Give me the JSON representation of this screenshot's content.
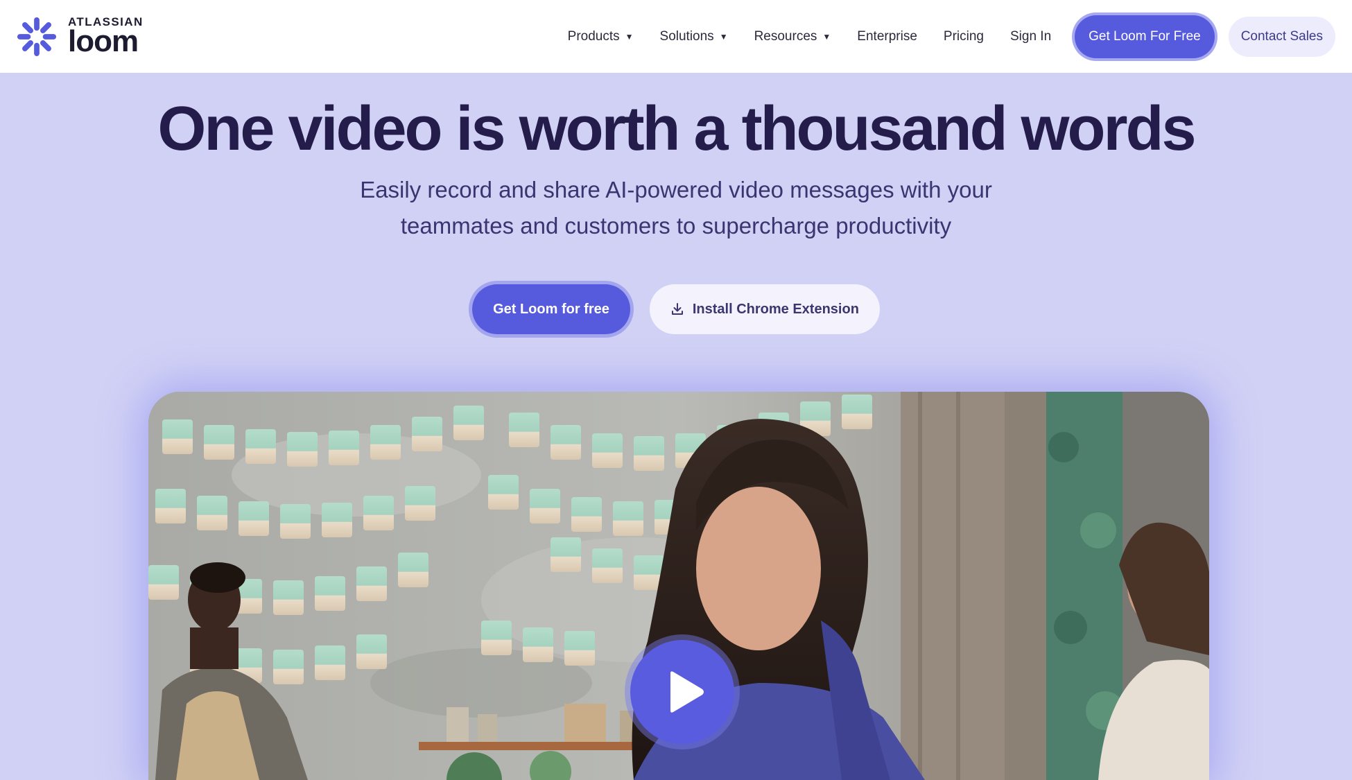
{
  "brand": {
    "company": "ATLASSIAN",
    "product": "loom",
    "logo_icon": "loom-asterisk-icon",
    "accent_color": "#565add"
  },
  "nav": {
    "items": [
      {
        "label": "Products",
        "has_dropdown": true
      },
      {
        "label": "Solutions",
        "has_dropdown": true
      },
      {
        "label": "Resources",
        "has_dropdown": true
      },
      {
        "label": "Enterprise",
        "has_dropdown": false
      },
      {
        "label": "Pricing",
        "has_dropdown": false
      },
      {
        "label": "Sign In",
        "has_dropdown": false
      }
    ],
    "cta_label": "Get Loom For Free",
    "contact_label": "Contact Sales"
  },
  "hero": {
    "title": "One video is worth a thousand words",
    "subtitle_line1": "Easily record and share AI-powered video messages with your",
    "subtitle_line2": "teammates and customers to supercharge productivity",
    "primary_button": "Get Loom for free",
    "secondary_button": "Install Chrome Extension",
    "secondary_icon": "download-icon"
  },
  "video": {
    "play_icon": "play-icon",
    "background_color": "#d1d1f5"
  }
}
